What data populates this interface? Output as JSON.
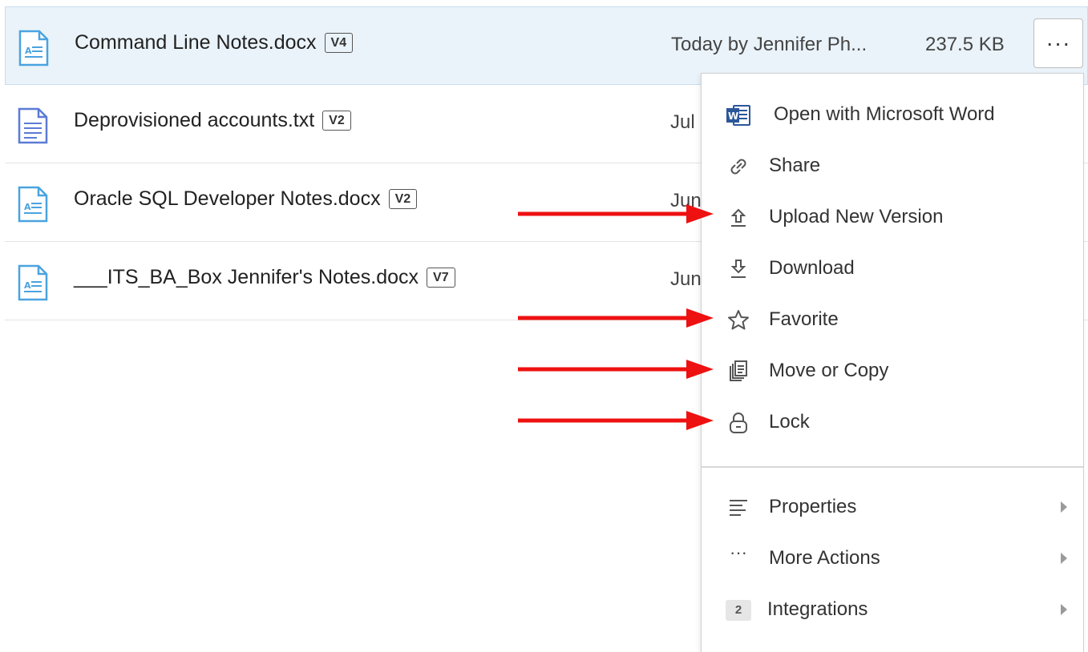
{
  "files": [
    {
      "name": "Command Line Notes.docx",
      "version": "V4",
      "modified": "Today by Jennifer Ph...",
      "size": "237.5 KB",
      "type": "docx"
    },
    {
      "name": "Deprovisioned accounts.txt",
      "version": "V2",
      "modified": "Jul",
      "type": "txt"
    },
    {
      "name": "Oracle SQL Developer Notes.docx",
      "version": "V2",
      "modified": "Jun",
      "type": "docx"
    },
    {
      "name": "___ITS_BA_Box Jennifer's Notes.docx",
      "version": "V7",
      "modified": "Jun",
      "type": "docx"
    }
  ],
  "more_button": {
    "icon": "ellipsis-icon",
    "label": "···"
  },
  "menu": {
    "items": [
      {
        "label": "Open with Microsoft Word",
        "icon": "microsoft-word-icon"
      },
      {
        "label": "Share",
        "icon": "link-icon"
      },
      {
        "label": "Upload New Version",
        "icon": "upload-icon"
      },
      {
        "label": "Download",
        "icon": "download-icon"
      },
      {
        "label": "Favorite",
        "icon": "star-icon"
      },
      {
        "label": "Move or Copy",
        "icon": "copy-icon"
      },
      {
        "label": "Lock",
        "icon": "lock-icon"
      }
    ],
    "submenus": [
      {
        "label": "Properties",
        "icon": "lines-icon"
      },
      {
        "label": "More Actions",
        "icon": "ellipsis-icon",
        "glyph": "···"
      },
      {
        "label": "Integrations",
        "badge": "2"
      }
    ]
  },
  "colors": {
    "selected_row": "#eaf3fa",
    "doc_icon": "#4aa3df",
    "txt_icon": "#5b7bd5",
    "word_blue": "#2b579a",
    "annotation_arrow": "#ee1111"
  }
}
